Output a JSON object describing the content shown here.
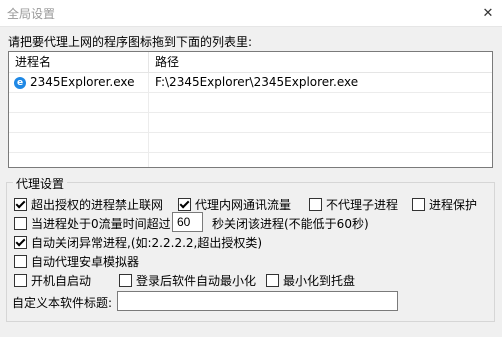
{
  "window": {
    "title": "全局设置",
    "close_glyph": "✕"
  },
  "instruction": "请把要代理上网的程序图标拖到下面的列表里:",
  "process_list": {
    "columns": [
      "进程名",
      "路径"
    ],
    "rows": [
      {
        "name": "2345Explorer.exe",
        "path": "F:\\2345Explorer\\2345Explorer.exe",
        "icon": "browser-e-icon"
      }
    ]
  },
  "proxy_settings": {
    "title": "代理设置",
    "options": {
      "block_unauthorized": {
        "label": "超出授权的进程禁止联网",
        "checked": true
      },
      "proxy_intranet": {
        "label": "代理内网通讯流量",
        "checked": true
      },
      "no_child_proxy": {
        "label": "不代理子进程",
        "checked": false
      },
      "process_protect": {
        "label": "进程保护",
        "checked": false
      },
      "zero_traffic": {
        "label": "当进程处于0流量时间超过",
        "checked": false,
        "seconds": "60",
        "suffix": "秒关闭该进程(不能低于60秒)"
      },
      "auto_close_abnormal": {
        "label": "自动关闭异常进程,(如:2.2.2.2,超出授权类)",
        "checked": true
      },
      "android_emulator": {
        "label": "自动代理安卓模拟器",
        "checked": false
      },
      "start_on_boot": {
        "label": "开机自启动",
        "checked": false
      },
      "minimize_after_login": {
        "label": "登录后软件自动最小化",
        "checked": false
      },
      "minimize_to_tray": {
        "label": "最小化到托盘",
        "checked": false
      }
    },
    "custom_title": {
      "label": "自定义本软件标题:",
      "value": ""
    }
  }
}
